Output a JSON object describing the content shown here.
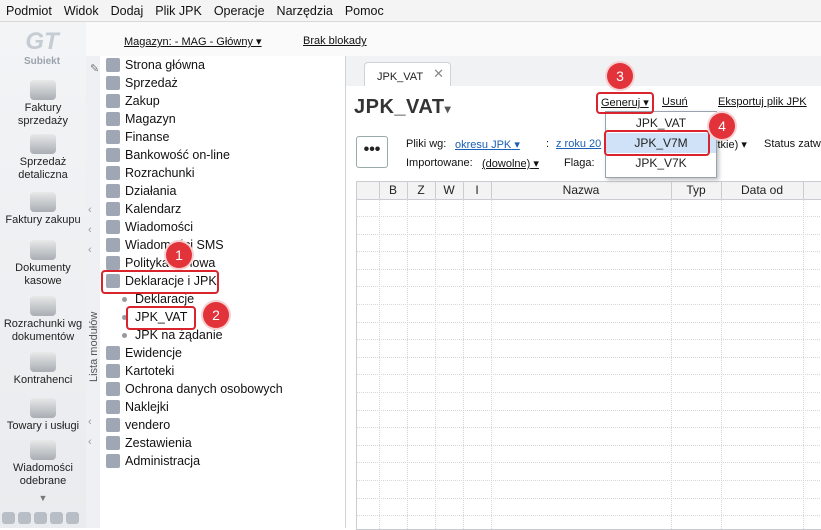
{
  "menu": [
    "Podmiot",
    "Widok",
    "Dodaj",
    "Plik JPK",
    "Operacje",
    "Narzędzia",
    "Pomoc"
  ],
  "toolbar": {
    "magazyn": "Magazyn: - MAG - Główny",
    "blokady": "Brak blokady"
  },
  "logo_text": "Subiekt",
  "leftbar": [
    "Faktury sprzedaży",
    "Sprzedaż detaliczna",
    "Faktury zakupu",
    "Dokumenty kasowe",
    "Rozrachunki wg dokumentów",
    "Kontrahenci",
    "Towary i usługi",
    "Wiadomości odebrane"
  ],
  "modules_label": "Lista modułów",
  "tree": [
    "Strona główna",
    "Sprzedaż",
    "Zakup",
    "Magazyn",
    "Finanse",
    "Bankowość on-line",
    "Rozrachunki",
    "Działania",
    "Kalendarz",
    "Wiadomości",
    "Wiadomości SMS",
    "Polityka cenowa",
    "Deklaracje i JPK",
    "Deklaracje",
    "JPK_VAT",
    "JPK na żądanie",
    "Ewidencje",
    "Kartoteki",
    "Ochrona danych osobowych",
    "Naklejki",
    "vendero",
    "Zestawienia",
    "Administracja"
  ],
  "tab": {
    "label": "JPK_VAT",
    "close": "✕"
  },
  "page": {
    "title": "JPK_VAT",
    "actions": {
      "generate": "Generuj",
      "delete": "Usuń",
      "export": "Eksportuj plik JPK"
    },
    "more": "•••",
    "filters": {
      "files_label": "Pliki wg:",
      "files_value": "okresu JPK",
      "period_value": "z roku 20",
      "period_suffix": "stkie)",
      "status_label": "Status zatw",
      "imported_label": "Importowane:",
      "imported_value": "(dowolne)",
      "flag_label": "Flaga:"
    }
  },
  "grid": {
    "columns": [
      "B",
      "Z",
      "W",
      "I",
      "Nazwa",
      "Typ",
      "Data od"
    ]
  },
  "dropdown": [
    "JPK_VAT",
    "JPK_V7M",
    "JPK_V7K"
  ],
  "badges": [
    "1",
    "2",
    "3",
    "4"
  ],
  "colors": {
    "highlight": "#d9232d",
    "link": "#1a5fb4",
    "selection": "#cfe2f7"
  }
}
